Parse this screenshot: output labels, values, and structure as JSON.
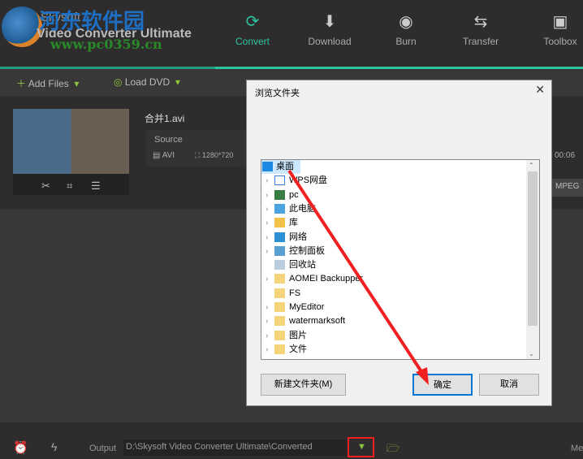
{
  "app": {
    "watermark_cn": "河东软件园",
    "brand": "Skysoft",
    "product": "Video Converter Ultimate",
    "watermark_url": "www.pc0359.cn"
  },
  "nav": [
    {
      "label": "Convert",
      "icon": "convert-icon"
    },
    {
      "label": "Download",
      "icon": "download-icon"
    },
    {
      "label": "Burn",
      "icon": "burn-icon"
    },
    {
      "label": "Transfer",
      "icon": "transfer-icon"
    },
    {
      "label": "Toolbox",
      "icon": "toolbox-icon"
    }
  ],
  "toolbar": {
    "add_files": "Add Files",
    "load_dvd": "Load DVD"
  },
  "file": {
    "name": "合并1.avi",
    "source_label": "Source",
    "format": "AVI",
    "resolution": "1280*720",
    "duration": "00:06",
    "target_format": "MPEG"
  },
  "dialog": {
    "title": "浏览文件夹",
    "tree": [
      {
        "label": "桌面",
        "icon": "desktop-icon",
        "expand": false,
        "selected": true,
        "indent": 0
      },
      {
        "label": "WPS网盘",
        "icon": "cloud-icon",
        "expand": true
      },
      {
        "label": "pc",
        "icon": "user-icon",
        "expand": true
      },
      {
        "label": "此电脑",
        "icon": "computer-icon",
        "expand": true
      },
      {
        "label": "库",
        "icon": "library-icon",
        "expand": true
      },
      {
        "label": "网络",
        "icon": "network-icon",
        "expand": true
      },
      {
        "label": "控制面板",
        "icon": "control-panel-icon",
        "expand": true
      },
      {
        "label": "回收站",
        "icon": "recycle-bin-icon",
        "expand": false
      },
      {
        "label": "AOMEI Backupper",
        "icon": "folder-icon",
        "expand": true
      },
      {
        "label": "FS",
        "icon": "folder-icon",
        "expand": false
      },
      {
        "label": "MyEditor",
        "icon": "folder-icon",
        "expand": true
      },
      {
        "label": "watermarksoft",
        "icon": "folder-icon",
        "expand": true
      },
      {
        "label": "图片",
        "icon": "folder-icon",
        "expand": true
      },
      {
        "label": "文件",
        "icon": "folder-icon",
        "expand": true
      }
    ],
    "new_folder": "新建文件夹(M)",
    "ok": "确定",
    "cancel": "取消"
  },
  "bottom": {
    "output_label": "Output",
    "output_path": "D:\\Skysoft Video Converter Ultimate\\Converted",
    "merge_partial": "Me"
  },
  "colors": {
    "accent": "#2bc49e",
    "green": "#8cc63f",
    "annotation": "#f02020"
  }
}
